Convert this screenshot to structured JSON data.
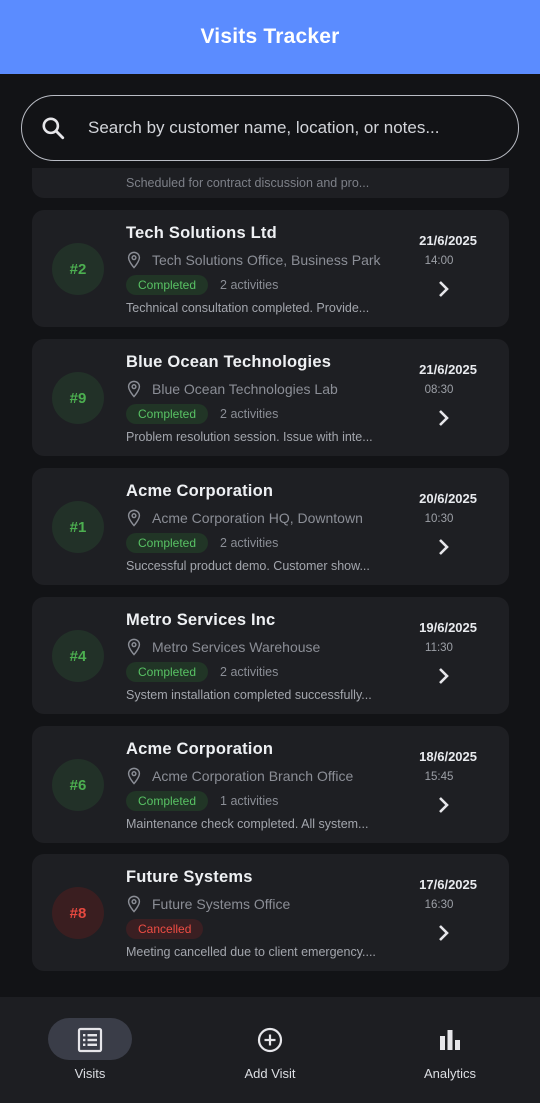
{
  "app": {
    "title": "Visits Tracker"
  },
  "search": {
    "placeholder": "Search by customer name, location, or notes..."
  },
  "partial_card": {
    "notes": "Scheduled for contract discussion and pro..."
  },
  "visits": [
    {
      "badge": "#2",
      "name": "Tech Solutions Ltd",
      "location": "Tech Solutions Office, Business Park",
      "status": "Completed",
      "activities": "2 activities",
      "notes": "Technical consultation completed. Provide...",
      "date": "21/6/2025",
      "time": "14:00"
    },
    {
      "badge": "#9",
      "name": "Blue Ocean Technologies",
      "location": "Blue Ocean Technologies Lab",
      "status": "Completed",
      "activities": "2 activities",
      "notes": "Problem resolution session. Issue with inte...",
      "date": "21/6/2025",
      "time": "08:30"
    },
    {
      "badge": "#1",
      "name": "Acme Corporation",
      "location": "Acme Corporation HQ, Downtown",
      "status": "Completed",
      "activities": "2 activities",
      "notes": "Successful product demo. Customer show...",
      "date": "20/6/2025",
      "time": "10:30"
    },
    {
      "badge": "#4",
      "name": "Metro Services Inc",
      "location": "Metro Services Warehouse",
      "status": "Completed",
      "activities": "2 activities",
      "notes": "System installation completed successfully...",
      "date": "19/6/2025",
      "time": "11:30"
    },
    {
      "badge": "#6",
      "name": "Acme Corporation",
      "location": "Acme Corporation Branch Office",
      "status": "Completed",
      "activities": "1 activities",
      "notes": "Maintenance check completed. All system...",
      "date": "18/6/2025",
      "time": "15:45"
    },
    {
      "badge": "#8",
      "name": "Future Systems",
      "location": "Future Systems Office",
      "status": "Cancelled",
      "activities": "",
      "notes": "Meeting cancelled due to client emergency....",
      "date": "17/6/2025",
      "time": "16:30"
    }
  ],
  "nav": {
    "items": [
      {
        "label": "Visits",
        "icon": "list-icon",
        "active": true
      },
      {
        "label": "Add Visit",
        "icon": "add-circle-icon",
        "active": false
      },
      {
        "label": "Analytics",
        "icon": "bar-chart-icon",
        "active": false
      }
    ]
  },
  "colors": {
    "accent": "#5b8cff",
    "completed": "#4caf50",
    "cancelled": "#e5483f",
    "background": "#121316",
    "card": "#1e1f23"
  }
}
